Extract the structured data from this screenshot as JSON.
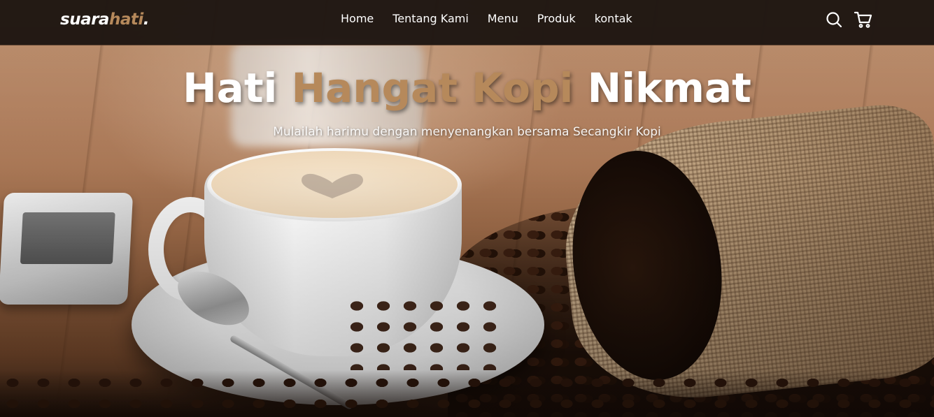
{
  "brand": {
    "logo_part1": "suara",
    "logo_part2": "hati",
    "logo_part3": ".",
    "accent_color": "#b6895b"
  },
  "nav": {
    "items": [
      {
        "label": "Home"
      },
      {
        "label": "Tentang Kami"
      },
      {
        "label": "Menu"
      },
      {
        "label": "Produk"
      },
      {
        "label": "kontak"
      }
    ],
    "icons": [
      "search-icon",
      "shopping-cart-icon"
    ]
  },
  "hero": {
    "title_word1": "Hati",
    "title_word2": "Hangat Kopi",
    "title_word3": "Nikmat",
    "subtitle": "Mulailah harimu dengan menyenangkan bersama Secangkir Kopi"
  },
  "colors": {
    "navbar_bg": "#1e1612",
    "text": "#ffffff",
    "accent": "#b6895b"
  }
}
